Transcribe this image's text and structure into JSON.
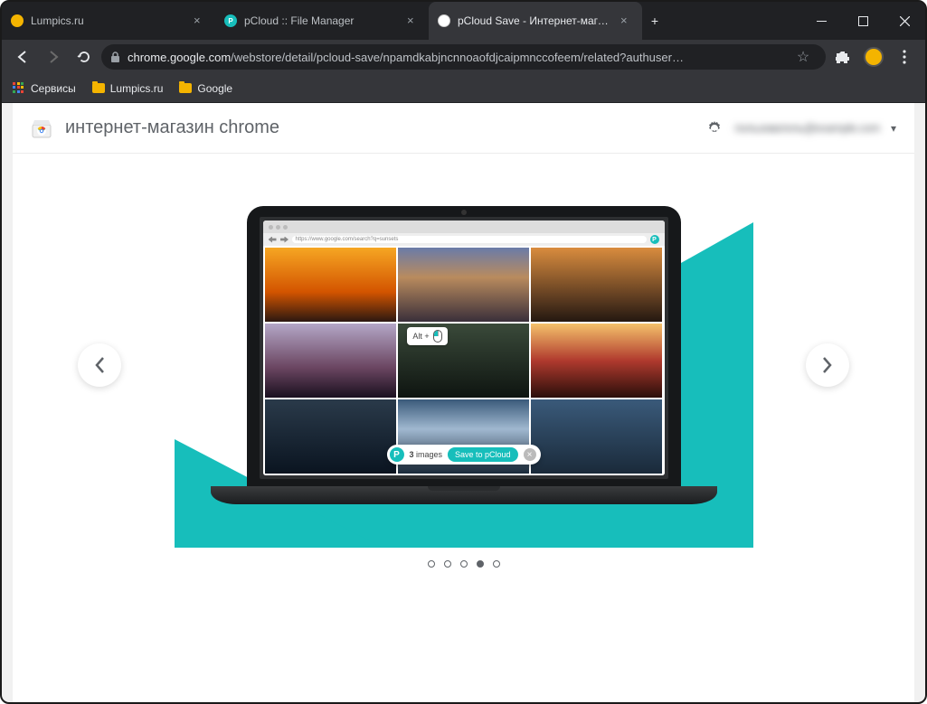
{
  "window": {
    "tabs": [
      {
        "title": "Lumpics.ru",
        "favicon": "#f4b400",
        "active": false
      },
      {
        "title": "pCloud :: File Manager",
        "favicon": "#17bebb",
        "active": false
      },
      {
        "title": "pCloud Save - Интернет-магази",
        "favicon": "#4285f4",
        "active": true
      }
    ]
  },
  "omnibox": {
    "domain": "chrome.google.com",
    "path": "/webstore/detail/pcloud-save/npamdkabjncnnoaofdjcaipmnccofeem/related?authuser…"
  },
  "bookmarks": {
    "apps": "Сервисы",
    "items": [
      {
        "label": "Lumpics.ru"
      },
      {
        "label": "Google"
      }
    ]
  },
  "store": {
    "title": "интернет-магазин chrome",
    "user_label_masked": "пользователь@example.com"
  },
  "slide_mock": {
    "mini_url": "https://www.google.com/search?q=sunsets",
    "alt_label": "Alt  +",
    "save_count_num": "3",
    "save_count_word": " images",
    "save_btn": "Save to pCloud"
  },
  "carousel": {
    "dots_total": 5,
    "active_index": 3
  },
  "img_colors": [
    "linear-gradient(180deg,#f6a623 0%,#d35400 60%,#2c1810 100%)",
    "linear-gradient(180deg,#6a7ba8 0%,#b98b5e 40%,#3a2f3a 100%)",
    "linear-gradient(180deg,#d98c3e 0%,#5a3a20 70%,#241810 100%)",
    "linear-gradient(180deg,#b4a7c7 0%,#6a4560 60%,#1a1020 100%)",
    "linear-gradient(180deg,#3a4a3a 0%,#0e1410 100%)",
    "linear-gradient(180deg,#f5c26b 0%,#b03a2e 50%,#2a0e0a 100%)",
    "linear-gradient(180deg,#2a3a4a 0%,#0a1420 100%)",
    "linear-gradient(180deg,#3a5a7a 0%,#a0b8d0 40%,#1a2a3a 100%)",
    "linear-gradient(180deg,#3a5a7a 0%,#1a2a3a 100%)"
  ]
}
